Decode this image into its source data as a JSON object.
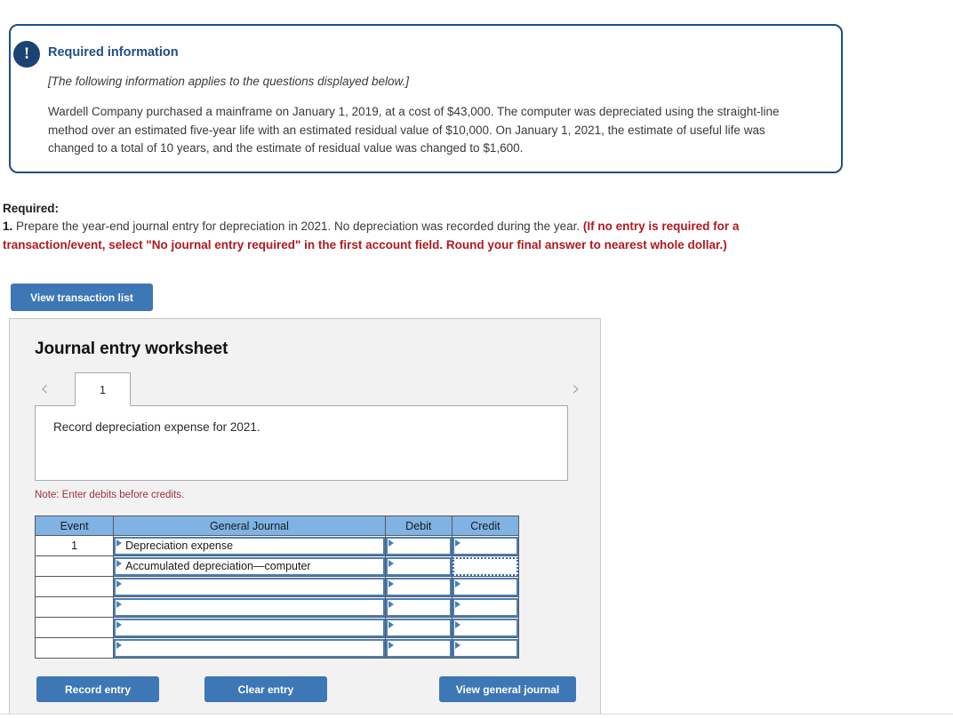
{
  "required_information": {
    "icon": "exclamation-icon",
    "badge_glyph": "!",
    "title": "Required information",
    "applies_note": "[The following information applies to the questions displayed below.]",
    "body": "Wardell Company purchased a mainframe on January 1, 2019, at a cost of $43,000. The computer was depreciated using the straight-line method over an estimated five-year life with an estimated residual value of $10,000. On January 1, 2021, the estimate of useful life was changed to a total of 10 years, and the estimate of residual value was changed to $1,600.",
    "border_color": "#1f4e86",
    "title_color": "#1f4e86"
  },
  "required_prompt": {
    "label": "Required:",
    "number": "1.",
    "text": " Prepare the year-end journal entry for depreciation in 2021. No depreciation was recorded during the year. ",
    "note": "(If no entry is required for a transaction/event, select \"No journal entry required\" in the first account field. Round your final answer to nearest whole dollar.)",
    "note_color": "#b01920"
  },
  "toolbar": {
    "view_transaction_list_label": "View transaction list",
    "button_color": "#3d77b5"
  },
  "worksheet": {
    "title": "Journal entry worksheet",
    "tabs": [
      {
        "label": "1",
        "active": true
      }
    ],
    "prev_chevron": "‹",
    "next_chevron": "›",
    "transaction_description": "Record depreciation expense for 2021.",
    "debits_note": "Note: Enter debits before credits.",
    "debits_note_color": "#a03038"
  },
  "journal_table": {
    "header_color": "#81b2e4",
    "columns": [
      "Event",
      "General Journal",
      "Debit",
      "Credit"
    ],
    "rows": [
      {
        "event": "1",
        "general_journal": "Depreciation expense",
        "debit": "",
        "credit": "",
        "credit_focused": false
      },
      {
        "event": "",
        "general_journal": "Accumulated depreciation—computer",
        "debit": "",
        "credit": "",
        "credit_focused": true
      },
      {
        "event": "",
        "general_journal": "",
        "debit": "",
        "credit": "",
        "credit_focused": false
      },
      {
        "event": "",
        "general_journal": "",
        "debit": "",
        "credit": "",
        "credit_focused": false
      },
      {
        "event": "",
        "general_journal": "",
        "debit": "",
        "credit": "",
        "credit_focused": false
      },
      {
        "event": "",
        "general_journal": "",
        "debit": "",
        "credit": "",
        "credit_focused": false
      }
    ]
  },
  "footer": {
    "record_entry_label": "Record entry",
    "clear_entry_label": "Clear entry",
    "view_general_journal_label": "View general journal"
  }
}
